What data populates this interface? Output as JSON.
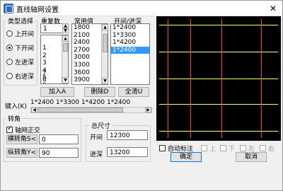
{
  "window": {
    "title": "直线轴网设置",
    "close_glyph": "✕"
  },
  "type_group": {
    "label": "类型选择",
    "options": [
      {
        "label": "上开间",
        "selected": false
      },
      {
        "label": "下开间",
        "selected": true
      },
      {
        "label": "左进深",
        "selected": false
      },
      {
        "label": "右进深",
        "selected": false
      }
    ]
  },
  "repeat": {
    "label": "重复数",
    "value": "1",
    "items": [
      "1",
      "1",
      "2",
      "3",
      "4",
      "5",
      "6",
      "7",
      "8"
    ]
  },
  "common": {
    "label": "常用值",
    "items": [
      "1800",
      "2100",
      "2400",
      "2700",
      "3000",
      "3300",
      "3600",
      "3900",
      "4200",
      "4500"
    ],
    "selected": "4200"
  },
  "open_depth": {
    "label": "开间/进深",
    "items": [
      "1*2400",
      "1*3300",
      "1*4200",
      "1*2400"
    ],
    "selected_index": 3
  },
  "buttons": {
    "add": "加入A",
    "delete": "删除D",
    "clear": "全清U",
    "ok": "确定",
    "cancel": "取消"
  },
  "key_in": {
    "label": "键入(K)",
    "value": "1*2400 1*3300 1*4200 1*2400"
  },
  "rotate": {
    "label": "转角",
    "orthogonal_label": "轴网正交",
    "orthogonal_checked": true,
    "horizontal_label": "横转角S<",
    "horizontal_value": "0",
    "vertical_label": "纵转角Y<",
    "vertical_value": "90"
  },
  "total": {
    "label": "总尺寸",
    "open_label": "开间",
    "open_value": "12300",
    "depth_label": "进深",
    "depth_value": "13200"
  },
  "annotations": {
    "auto_label": "自动标注",
    "top": "上",
    "bottom": "下",
    "left": "左",
    "right": "右"
  },
  "colors": {
    "canvas_bg": "#000000",
    "horizontal_axis": "#ffff66",
    "vertical_axis": "#ff3b3b",
    "selection": "#3399ff"
  }
}
